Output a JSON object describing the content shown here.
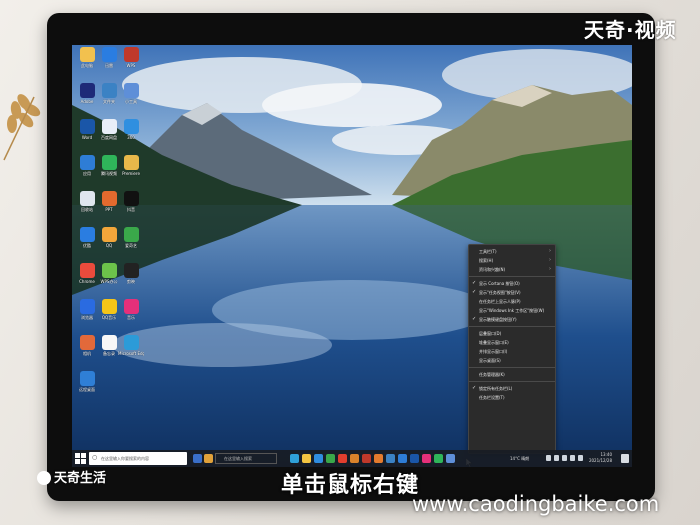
{
  "watermarks": {
    "top_right": "天奇·视频",
    "bottom_left": "天奇生活",
    "url": "www.caodingbaike.com"
  },
  "caption": "单击鼠标右键",
  "taskbar": {
    "search_text": "在这里输入你要搜索的内容",
    "search2_text": "在这里输入搜索",
    "weather": "14°C 晴朗",
    "time": "13:40",
    "date": "2021/12/28"
  },
  "context_menu": {
    "items": [
      {
        "label": "工具栏(T)",
        "submenu": true,
        "checked": false
      },
      {
        "label": "搜索(H)",
        "submenu": true,
        "checked": false
      },
      {
        "label": "资讯和兴趣(N)",
        "submenu": true,
        "checked": false
      },
      {
        "label": "显示 Cortana 按钮(O)",
        "submenu": false,
        "checked": true
      },
      {
        "label": "显示\"任务视图\"按钮(V)",
        "submenu": false,
        "checked": true
      },
      {
        "label": "在任务栏上显示人脉(P)",
        "submenu": false,
        "checked": false
      },
      {
        "label": "显示\"Windows Ink 工作区\"按钮(W)",
        "submenu": false,
        "checked": false
      },
      {
        "label": "显示触摸键盘按钮(Y)",
        "submenu": false,
        "checked": true
      },
      {
        "label": "层叠窗口(D)",
        "submenu": false,
        "checked": false
      },
      {
        "label": "堆叠显示窗口(E)",
        "submenu": false,
        "checked": false
      },
      {
        "label": "并排显示窗口(I)",
        "submenu": false,
        "checked": false
      },
      {
        "label": "显示桌面(S)",
        "submenu": false,
        "checked": false
      },
      {
        "label": "任务管理器(K)",
        "submenu": false,
        "checked": false
      },
      {
        "label": "锁定所有任务栏(L)",
        "submenu": false,
        "checked": true
      },
      {
        "label": "任务栏设置(T)",
        "submenu": false,
        "checked": false
      }
    ],
    "separators_after": [
      2,
      7,
      11,
      12
    ]
  },
  "desktop_icons": [
    {
      "label": "此电脑",
      "color": "#f2c14e"
    },
    {
      "label": "迅雷",
      "color": "#2a7de1"
    },
    {
      "label": "WPS",
      "color": "#c0392b"
    },
    {
      "label": "Adobe",
      "color": "#1e2a78"
    },
    {
      "label": "文件夹",
      "color": "#3b82c4"
    },
    {
      "label": "小工具",
      "color": "#5e8fd8"
    },
    {
      "label": "Word",
      "color": "#1a56a8"
    },
    {
      "label": "百度网盘",
      "color": "#e8eef8"
    },
    {
      "label": "360",
      "color": "#2f8fe0"
    },
    {
      "label": "应用",
      "color": "#2e7dd6"
    },
    {
      "label": "腾讯视频",
      "color": "#2fb55a"
    },
    {
      "label": "Premiere",
      "color": "#e8b84a"
    },
    {
      "label": "回收站",
      "color": "#dfe6ee"
    },
    {
      "label": "PPT",
      "color": "#e36a2e"
    },
    {
      "label": "抖音",
      "color": "#111111"
    },
    {
      "label": "优酷",
      "color": "#2a7de1"
    },
    {
      "label": "QQ",
      "color": "#f2a63a"
    },
    {
      "label": "爱奇艺",
      "color": "#3aa84a"
    },
    {
      "label": "Chrome",
      "color": "#e94b3c"
    },
    {
      "label": "WPS办公",
      "color": "#6cc24a"
    },
    {
      "label": "剪映",
      "color": "#222222"
    },
    {
      "label": "浏览器",
      "color": "#2a6be1"
    },
    {
      "label": "QQ音乐",
      "color": "#f5c518"
    },
    {
      "label": "音乐",
      "color": "#e5307a"
    },
    {
      "label": "相机",
      "color": "#e2693a"
    },
    {
      "label": "备忘录",
      "color": "#f7f7f7"
    },
    {
      "label": "Microsoft Edge",
      "color": "#2c9bd8"
    },
    {
      "label": "远程桌面",
      "color": "#2f7fd6"
    }
  ],
  "colors": {
    "menu_bg": "#2b2b2b",
    "taskbar_bg": "#181c24"
  }
}
